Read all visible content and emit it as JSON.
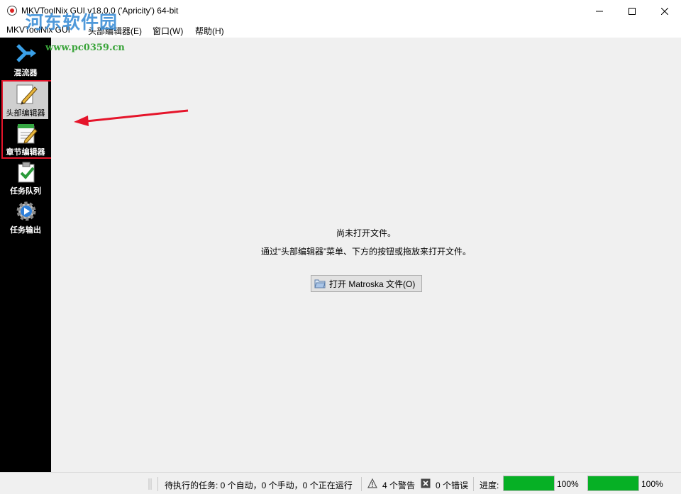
{
  "window": {
    "title": "MKVToolNix GUI v18.0.0 ('Apricity') 64-bit",
    "controls": [
      "minimize-icon",
      "maximize-icon",
      "close-icon"
    ]
  },
  "menu": {
    "items": [
      "MKVToolNix GUI",
      "头部编辑器(E)",
      "窗口(W)",
      "帮助(H)"
    ]
  },
  "watermark": {
    "title": "河东软件园",
    "url": "www.pc0359.cn"
  },
  "sidebar": {
    "items": [
      {
        "label": "混流器",
        "icon": "merge-icon",
        "active": false
      },
      {
        "label": "头部编辑器",
        "icon": "pencil-icon",
        "active": true
      },
      {
        "label": "章节编辑器",
        "icon": "notepad-icon",
        "active": false
      },
      {
        "label": "任务队列",
        "icon": "checklist-icon",
        "active": false
      },
      {
        "label": "任务输出",
        "icon": "gear-play-icon",
        "active": false
      }
    ]
  },
  "main": {
    "message1": "尚未打开文件。",
    "message2": "通过“头部编辑器”菜单、下方的按钮或拖放来打开文件。",
    "open_button": "打开 Matroska 文件(O)"
  },
  "status": {
    "pending_jobs": "待执行的任务: 0 个自动，0 个手动，0 个正在运行",
    "warnings": "4 个警告",
    "errors": "0 个错误",
    "progress_label": "进度:",
    "progress1_text": "100%",
    "progress1_value": 100,
    "progress2_text": "100%",
    "progress2_value": 100
  },
  "colors": {
    "highlight_box": "#e5142a",
    "progress_fill": "#06b025",
    "sidebar_bg": "#000000"
  }
}
